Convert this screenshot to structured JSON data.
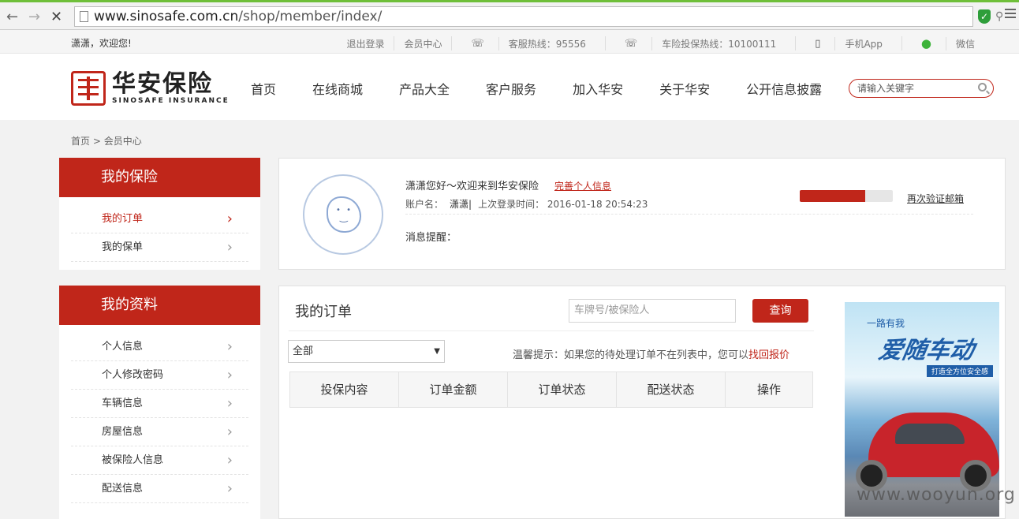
{
  "browser": {
    "url_host": "www.sinosafe.com.cn",
    "url_path": "/shop/member/index/"
  },
  "topbar": {
    "welcome": "潇潇，欢迎您!",
    "logout": "退出登录",
    "member_center": "会员中心",
    "hotline": "客服热线：95556",
    "car_hotline": "车险投保热线：10100111",
    "mobile_app": "手机App",
    "wechat": "微信"
  },
  "header": {
    "logo_cn": "华安保险",
    "logo_en": "SINOSAFE INSURANCE",
    "nav": [
      "首页",
      "在线商城",
      "产品大全",
      "客户服务",
      "加入华安",
      "关于华安",
      "公开信息披露"
    ],
    "search_placeholder": "请输入关键字"
  },
  "breadcrumb": {
    "home": "首页",
    "sep": " > ",
    "current": "会员中心"
  },
  "sidebar": {
    "insurance": {
      "title": "我的保险",
      "items": [
        "我的订单",
        "我的保单"
      ]
    },
    "profile": {
      "title": "我的资料",
      "items": [
        "个人信息",
        "个人修改密码",
        "车辆信息",
        "房屋信息",
        "被保险人信息",
        "配送信息"
      ]
    }
  },
  "profile": {
    "greeting": "潇潇您好～欢迎来到华安保险",
    "complete_link": "完善个人信息",
    "account_label": "账户名：",
    "account_name": "潇潇|",
    "last_login_label": "上次登录时间：",
    "last_login": "2016-01-18 20:54:23",
    "message_label": "消息提醒：",
    "verify_email": "再次验证邮箱",
    "progress": 0.7
  },
  "orders": {
    "title": "我的订单",
    "search_placeholder": "车牌号/被保险人",
    "search_button": "查询",
    "filter_selected": "全部",
    "tip_text": "温馨提示：如果您的待处理订单不在列表中，您可以",
    "tip_link": "找回报价",
    "columns": [
      "投保内容",
      "订单金额",
      "订单状态",
      "配送状态",
      "操作"
    ]
  },
  "ad": {
    "subtitle": "一路有我",
    "headline": "爱随车动",
    "tagline": "打造全方位安全感"
  },
  "watermark": "www.wooyun.org",
  "colors": {
    "brand_red": "#c0261a",
    "browser_accent": "#6fbf3a"
  }
}
